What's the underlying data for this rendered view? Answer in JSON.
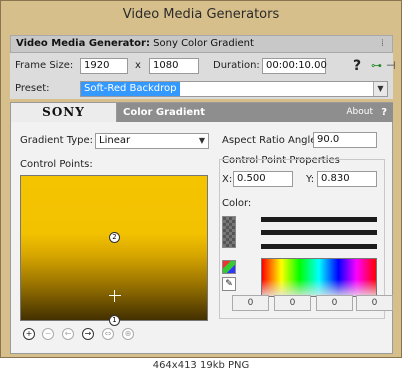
{
  "window": {
    "title": "Video Media Generators"
  },
  "generator": {
    "label": "Video Media Generator:",
    "value": "Sony Color Gradient"
  },
  "frame": {
    "size_label": "Frame Size:",
    "width": "1920",
    "x_label": "x",
    "height": "1080",
    "duration_label": "Duration:",
    "duration": "00:00:10.00"
  },
  "preset": {
    "label": "Preset:",
    "value": "Soft-Red Backdrop"
  },
  "plugin": {
    "brand": "SONY",
    "name": "Color Gradient",
    "about": "About",
    "help": "?"
  },
  "gradient": {
    "type_label": "Gradient Type:",
    "type_value": "Linear",
    "aspect_label": "Aspect Ratio Angle:",
    "aspect_value": "90.0"
  },
  "control_points": {
    "label": "Control Points:",
    "point1": "1",
    "point2": "2"
  },
  "cp_props": {
    "title": "Control Point Properties",
    "x_label": "X:",
    "x_value": "0.500",
    "y_label": "Y:",
    "y_value": "0.830"
  },
  "color": {
    "label": "Color:",
    "r": "0",
    "g": "0",
    "b": "0",
    "a": "0"
  },
  "icons": {
    "help": "?",
    "plug": "⊶",
    "pin": "⊣"
  },
  "footer": {
    "caption": "464x413 19kb PNG"
  },
  "colors": {
    "window_bg": "#d7bf8b",
    "selection": "#3399ff",
    "gradient_top": "#f5c400",
    "gradient_bottom": "#433000"
  }
}
